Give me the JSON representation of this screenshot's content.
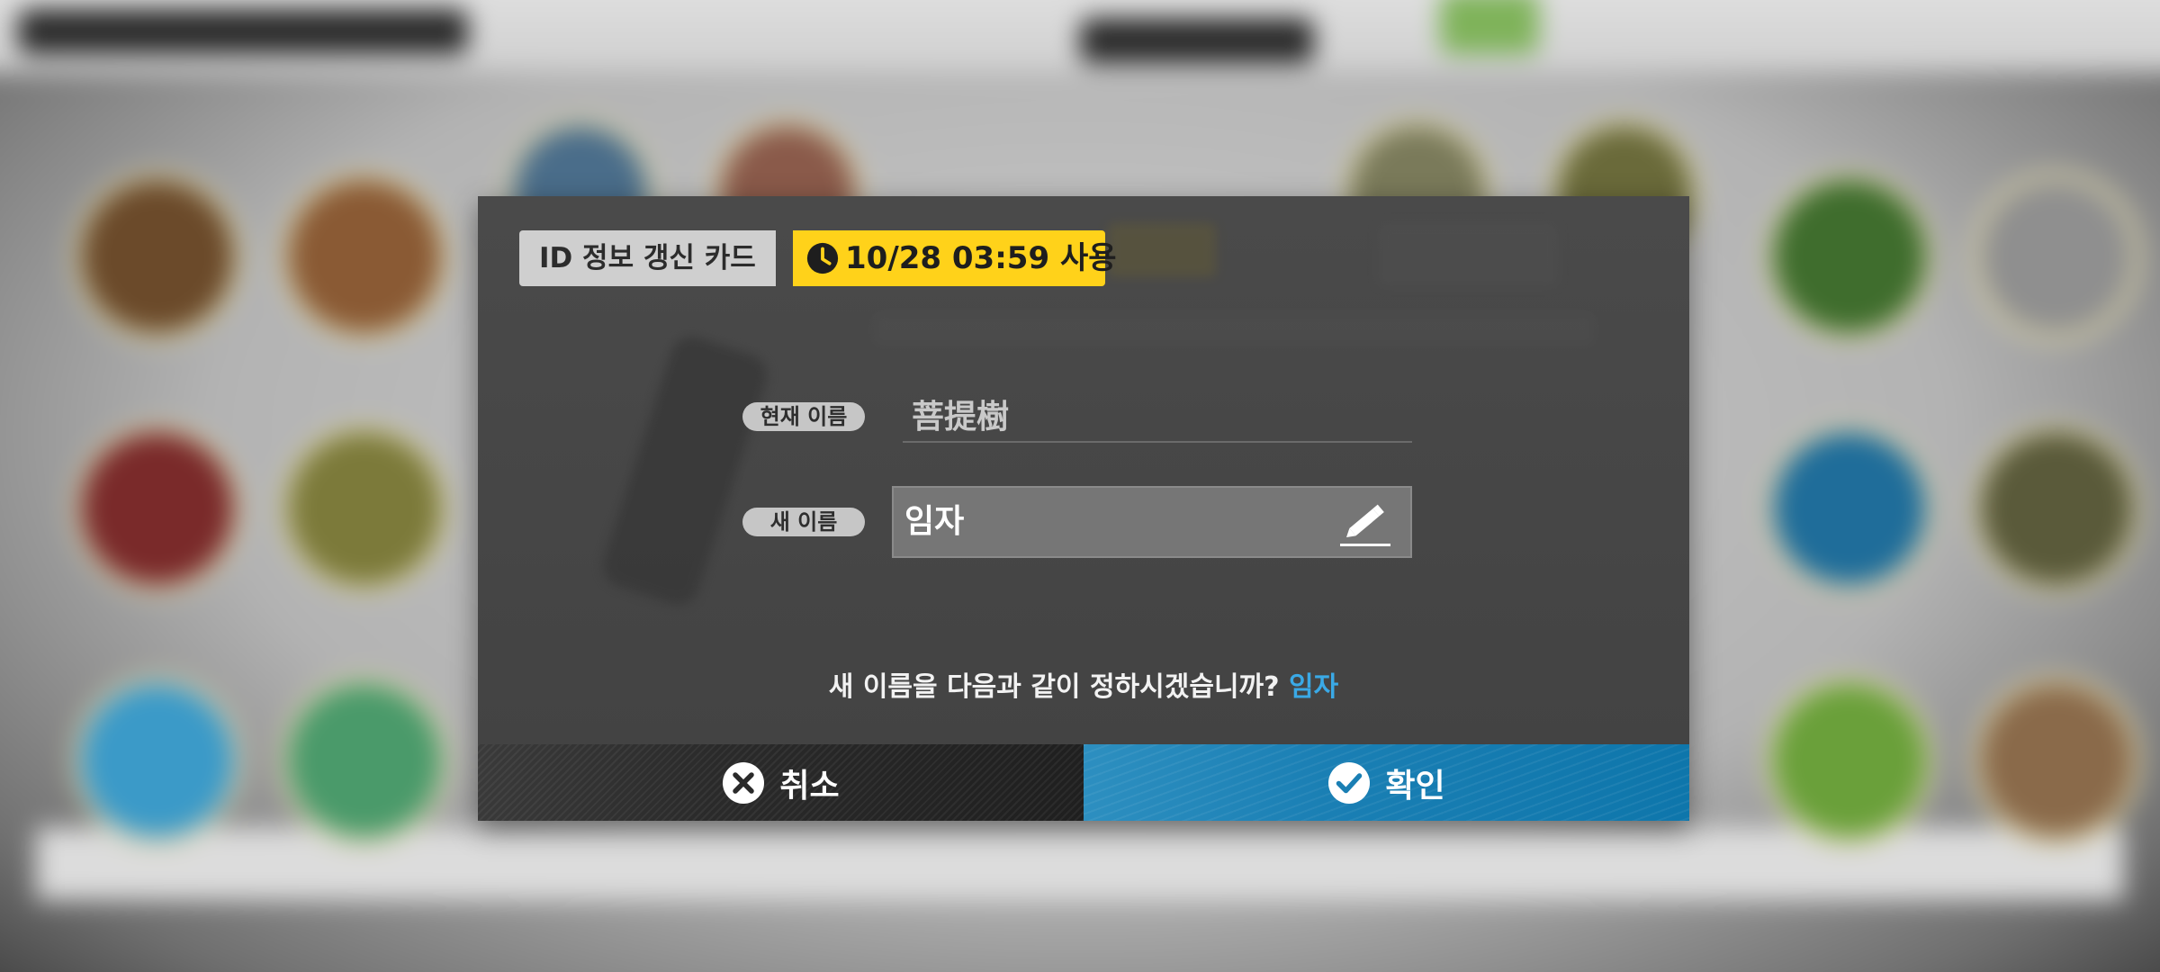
{
  "dialog": {
    "title": "ID 정보 갱신 카드",
    "expiry": "10/28 03:59 사용",
    "current_name_label": "현재 이름",
    "current_name": "菩提樹",
    "new_name_label": "새 이름",
    "new_name": "임자",
    "question": "새 이름을 다음과 같이 정하시겠습니까?",
    "question_name": "임자",
    "cancel_label": "취소",
    "confirm_label": "확인"
  },
  "colors": {
    "expiry_tag": "#ffd21a",
    "confirm_button": "#1a7fb4",
    "highlight_text": "#3aa9e6"
  },
  "icons": {
    "expiry": "clock-icon",
    "edit": "pencil-icon",
    "cancel": "close-circle-icon",
    "confirm": "check-circle-icon"
  }
}
